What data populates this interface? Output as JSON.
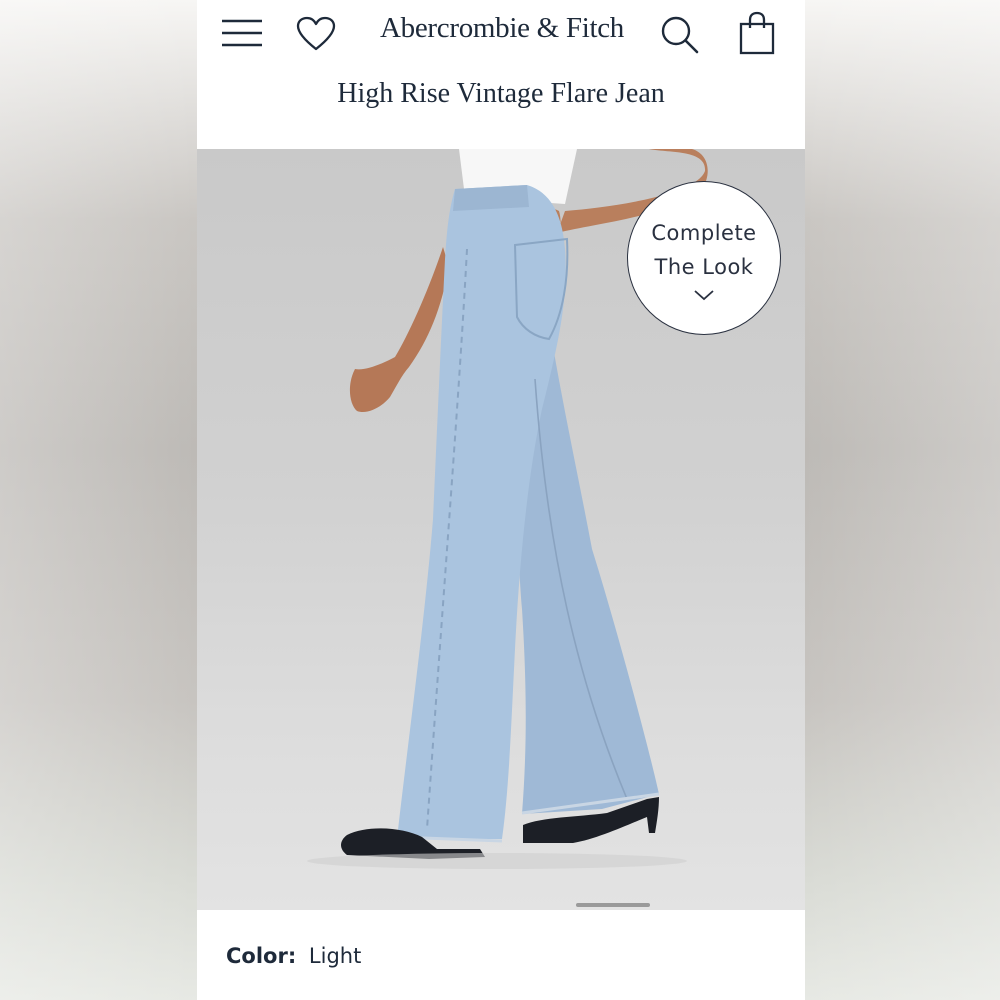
{
  "header": {
    "brand": "Abercrombie & Fitch",
    "icons": [
      "menu-icon",
      "heart-icon",
      "search-icon",
      "shopping-bag-icon"
    ]
  },
  "product": {
    "title": "High Rise Vintage Flare Jean",
    "complete_look": {
      "line1": "Complete",
      "line2": "The Look",
      "icon": "chevron-down-icon"
    },
    "color_label": "Color:",
    "color_value": "Light"
  },
  "colors": {
    "text_primary": "#1e2a3a",
    "denim": "#a9c3de",
    "background_photo": "#d0d0d0"
  }
}
